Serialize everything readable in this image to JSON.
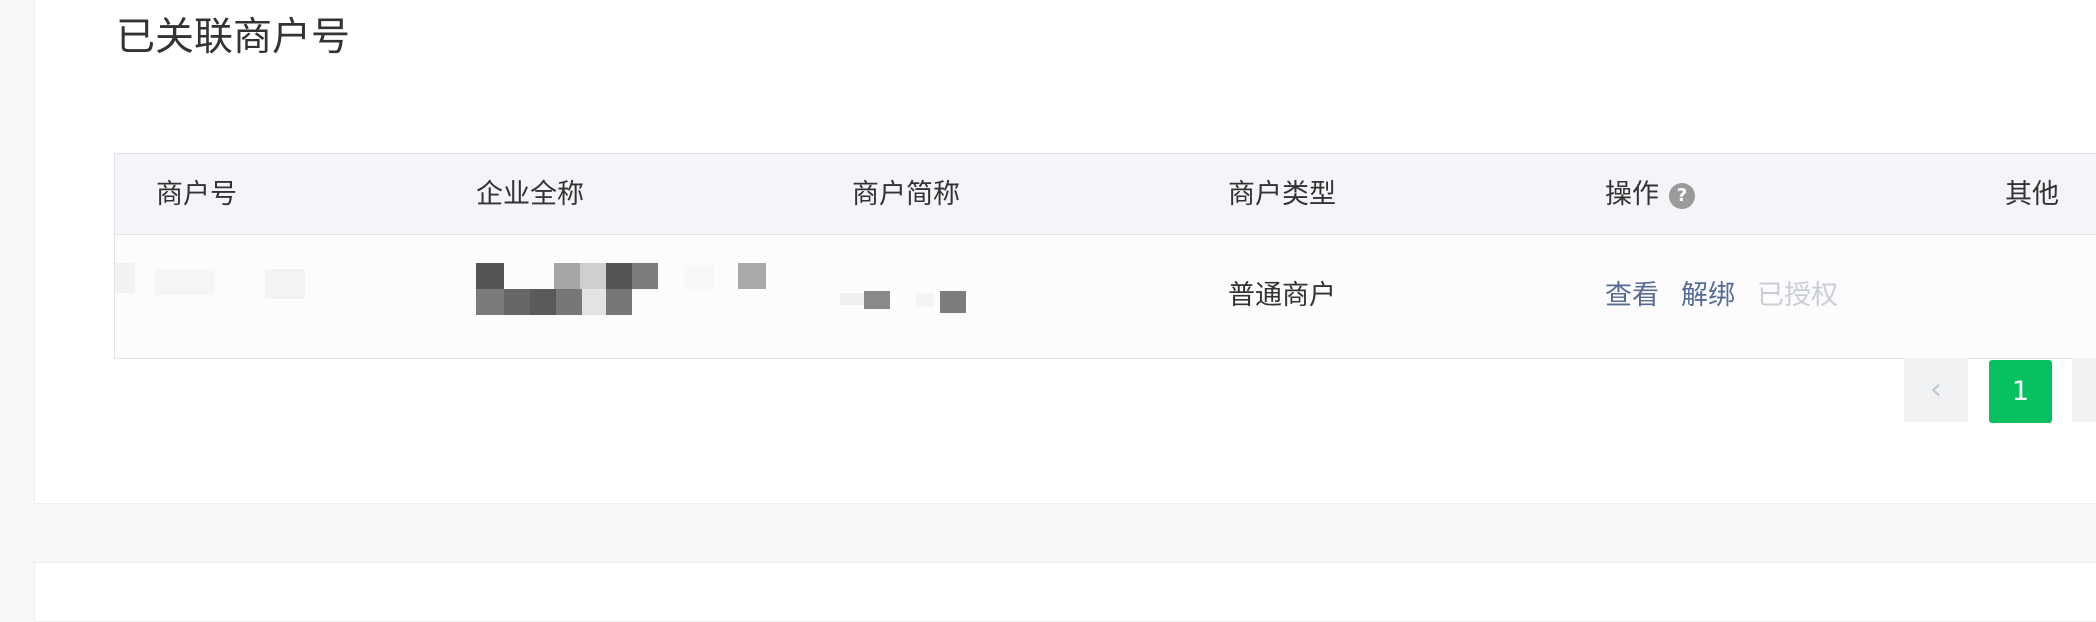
{
  "page_title": "已关联商户号",
  "table": {
    "columns": {
      "merchant_id": "商户号",
      "company_full_name": "企业全称",
      "merchant_short_name": "商户简称",
      "merchant_type": "商户类型",
      "actions": "操作",
      "other": "其他"
    },
    "help_icon_glyph": "?",
    "rows": [
      {
        "merchant_type": "普通商户",
        "actions": {
          "view": "查看",
          "unbind": "解绑",
          "authorized": "已授权"
        }
      }
    ]
  },
  "pagination": {
    "prev_glyph": "‹",
    "current_page": "1"
  },
  "colors": {
    "accent": "#07c160",
    "link": "#576b95",
    "disabled_link": "#c9ced6",
    "header_bg": "#f4f5f8"
  },
  "icons": {
    "help": "question-circle-icon",
    "prev": "chevron-left-icon"
  }
}
